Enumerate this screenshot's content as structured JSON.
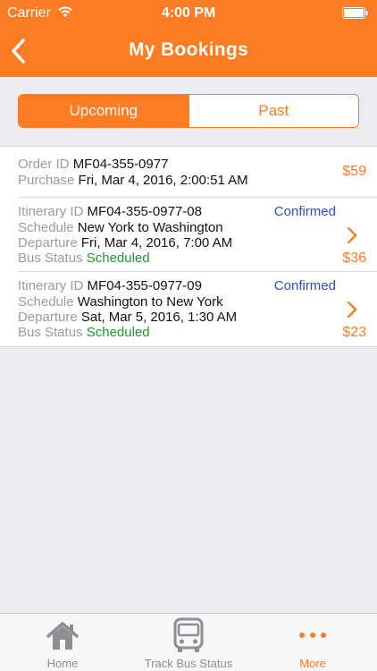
{
  "status_bar": {
    "carrier": "Carrier",
    "time": "4:00 PM"
  },
  "header": {
    "title": "My Bookings"
  },
  "segmented": {
    "upcoming": "Upcoming",
    "past": "Past",
    "selected": "Upcoming"
  },
  "order": {
    "id_label": "Order ID",
    "id": "MF04-355-0977",
    "purchase_label": "Purchase",
    "purchase": "Fri, Mar 4, 2016, 2:00:51 AM",
    "price": "$59"
  },
  "itineraries": [
    {
      "id_label": "Itinerary ID",
      "id": "MF04-355-0977-08",
      "status": "Confirmed",
      "schedule_label": "Schedule",
      "schedule": "New York to Washington",
      "departure_label": "Departure",
      "departure": "Fri, Mar 4, 2016, 7:00 AM",
      "bus_status_label": "Bus Status",
      "bus_status": "Scheduled",
      "price": "$36"
    },
    {
      "id_label": "Itinerary ID",
      "id": "MF04-355-0977-09",
      "status": "Confirmed",
      "schedule_label": "Schedule",
      "schedule": "Washington to New York",
      "departure_label": "Departure",
      "departure": "Sat, Mar 5, 2016, 1:30 AM",
      "bus_status_label": "Bus Status",
      "bus_status": "Scheduled",
      "price": "$23"
    }
  ],
  "tab_bar": {
    "home": "Home",
    "track": "Track Bus Status",
    "more": "More",
    "active": "More"
  },
  "colors": {
    "accent": "#fd7b22",
    "confirmed": "#2e4fbd",
    "scheduled": "#1f9a2d",
    "muted_label": "#9b9b9f"
  }
}
